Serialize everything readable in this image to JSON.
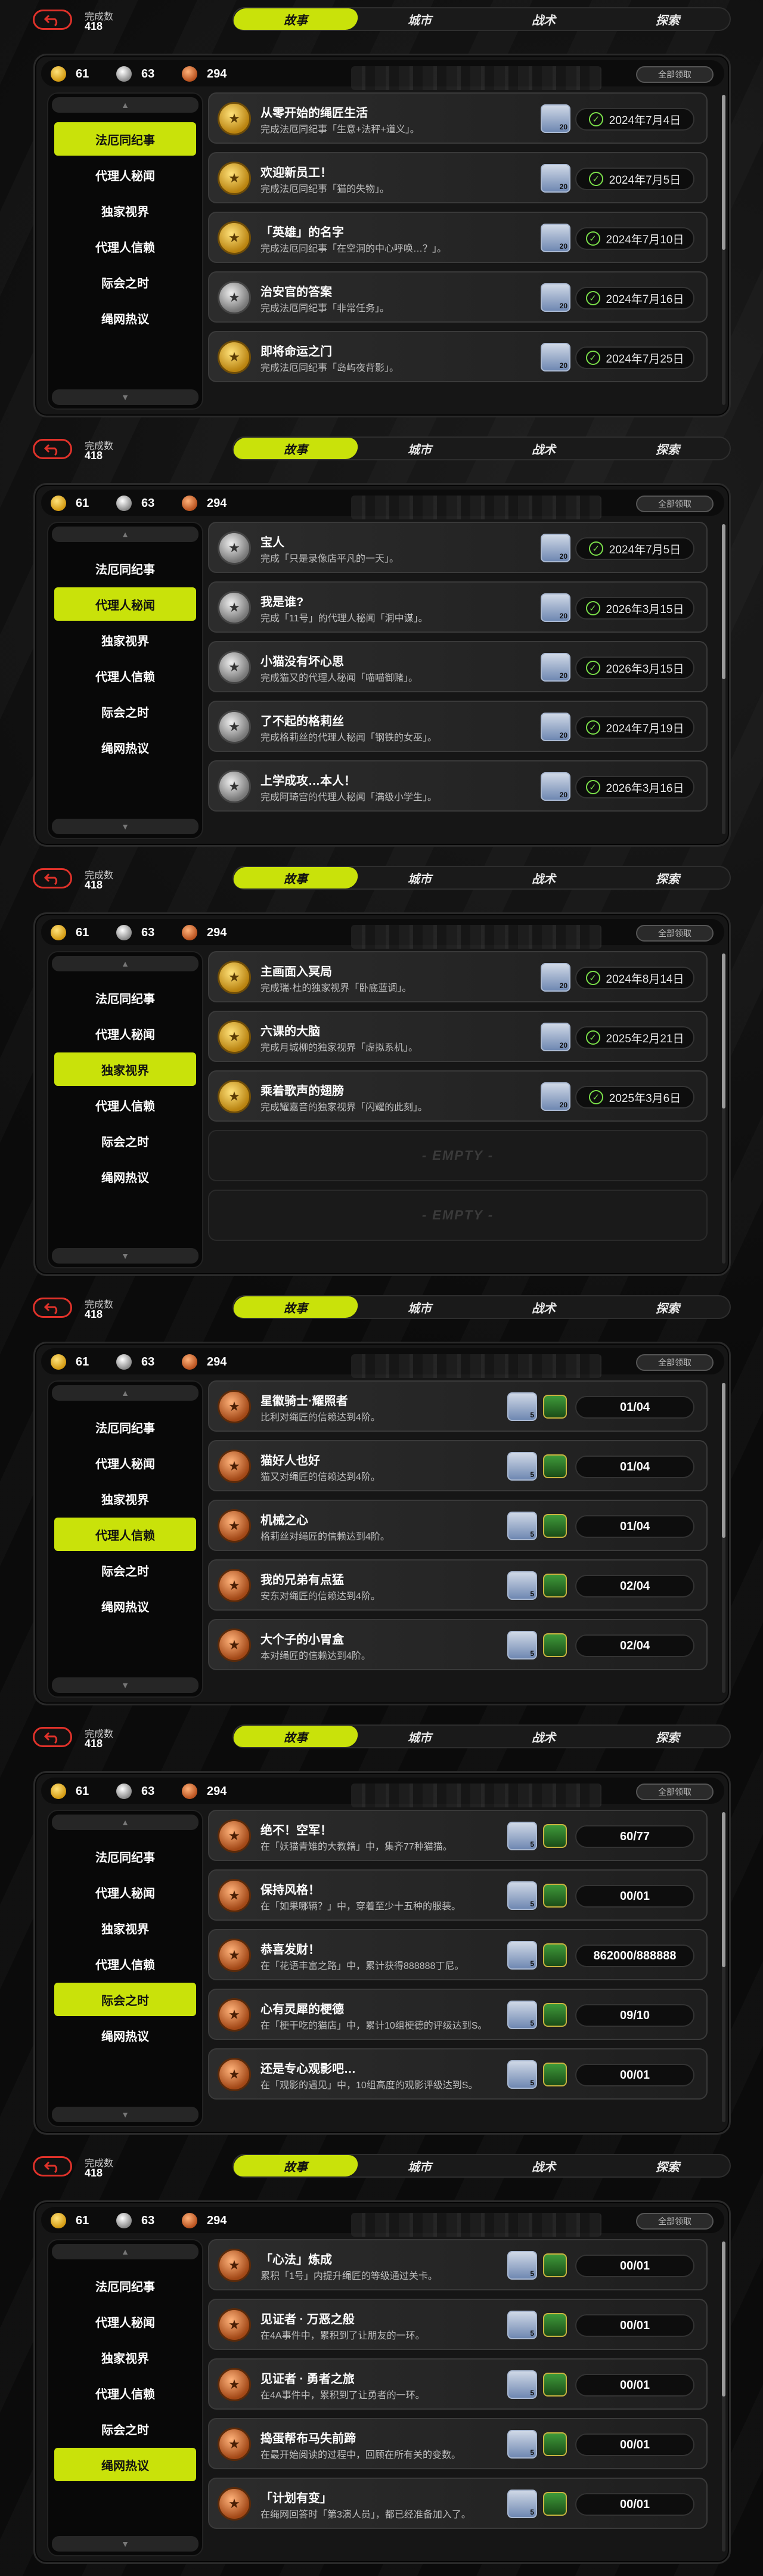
{
  "header": {
    "completion_label": "完成数",
    "completion_value": "418",
    "tabs": [
      "故事",
      "城市",
      "战术",
      "探索"
    ],
    "active_tab": 0
  },
  "currency": {
    "gold": "61",
    "silver": "63",
    "bronze": "294"
  },
  "claim_all_label": "全部领取",
  "categories": [
    "法厄同纪事",
    "代理人秘闻",
    "独家视界",
    "代理人信赖",
    "际会之时",
    "绳网热议"
  ],
  "screens": [
    {
      "active_category": 0,
      "cards": [
        {
          "medal": "gold",
          "title": "从零开始的绳匠生活",
          "desc": "完成法厄同纪事「生意+法秤+道义」。",
          "reward_qty": "20",
          "date": "2024年7月4日"
        },
        {
          "medal": "gold",
          "title": "欢迎新员工！",
          "desc": "完成法厄同纪事「猫的失物」。",
          "reward_qty": "20",
          "date": "2024年7月5日"
        },
        {
          "medal": "gold",
          "title": "「英雄」的名字",
          "desc": "完成法厄同纪事「在空洞的中心呼唤…？」。",
          "reward_qty": "20",
          "date": "2024年7月10日"
        },
        {
          "medal": "grey",
          "title": "治安官的答案",
          "desc": "完成法厄同纪事「非常任务」。",
          "reward_qty": "20",
          "date": "2024年7月16日"
        },
        {
          "medal": "gold",
          "title": "即将命运之门",
          "desc": "完成法厄同纪事「岛屿夜背影」。",
          "reward_qty": "20",
          "date": "2024年7月25日"
        }
      ]
    },
    {
      "active_category": 1,
      "cards": [
        {
          "medal": "grey",
          "title": "宝人",
          "desc": "完成「只是录像店平凡的一天」。",
          "reward_qty": "20",
          "date": "2024年7月5日"
        },
        {
          "medal": "grey",
          "title": "我是谁?",
          "desc": "完成「11号」的代理人秘闻「洞中谋」。",
          "reward_qty": "20",
          "date": "2026年3月15日"
        },
        {
          "medal": "grey",
          "title": "小猫没有坏心思",
          "desc": "完成猫又的代理人秘闻「喵喵御赌」。",
          "reward_qty": "20",
          "date": "2026年3月15日"
        },
        {
          "medal": "grey",
          "title": "了不起的格莉丝",
          "desc": "完成格莉丝的代理人秘闻「钢铁的女巫」。",
          "reward_qty": "20",
          "date": "2024年7月19日"
        },
        {
          "medal": "grey",
          "title": "上学成攻…本人！",
          "desc": "完成阿琦宫的代理人秘闻「满级小学生」。",
          "reward_qty": "20",
          "date": "2026年3月16日"
        }
      ]
    },
    {
      "active_category": 2,
      "cards": [
        {
          "medal": "gold",
          "title": "主画面入冥局",
          "desc": "完成瑞·杜的独家视界「卧底蓝调」。",
          "reward_qty": "20",
          "date": "2024年8月14日"
        },
        {
          "medal": "gold",
          "title": "六课的大脑",
          "desc": "完成月城柳的独家视界「虚拟系机」。",
          "reward_qty": "20",
          "date": "2025年2月21日"
        },
        {
          "medal": "gold",
          "title": "乘着歌声的翅膀",
          "desc": "完成耀嘉音的独家视界「闪耀的此刻」。",
          "reward_qty": "20",
          "date": "2025年3月6日"
        }
      ],
      "empty_label": "- EMPTY -",
      "empty_count": 2
    },
    {
      "active_category": 3,
      "cards": [
        {
          "medal": "bronze",
          "title": "星徽骑士·耀照者",
          "desc": "比利对绳匠的信赖达到4阶。",
          "reward_qty": "5",
          "progress": "01/04"
        },
        {
          "medal": "bronze",
          "title": "猫好人也好",
          "desc": "猫又对绳匠的信赖达到4阶。",
          "reward_qty": "5",
          "progress": "01/04"
        },
        {
          "medal": "bronze",
          "title": "机械之心",
          "desc": "格莉丝对绳匠的信赖达到4阶。",
          "reward_qty": "5",
          "progress": "01/04"
        },
        {
          "medal": "bronze",
          "title": "我的兄弟有点猛",
          "desc": "安东对绳匠的信赖达到4阶。",
          "reward_qty": "5",
          "progress": "02/04"
        },
        {
          "medal": "bronze",
          "title": "大个子的小胃盒",
          "desc": "本对绳匠的信赖达到4阶。",
          "reward_qty": "5",
          "progress": "02/04"
        }
      ]
    },
    {
      "active_category": 4,
      "cards": [
        {
          "medal": "bronze",
          "title": "绝不！空军！",
          "desc": "在「妖猫青雉的大教籍」中，集齐77种猫猫。",
          "reward_qty": "5",
          "progress": "60/77"
        },
        {
          "medal": "bronze",
          "title": "保持风格！",
          "desc": "在「如果哪辆？」中，穿着至少十五种的服装。",
          "reward_qty": "5",
          "progress": "00/01"
        },
        {
          "medal": "bronze",
          "title": "恭喜发财！",
          "desc": "在「花语丰富之路」中，累计获得888888丁尼。",
          "reward_qty": "5",
          "progress": "862000/888888"
        },
        {
          "medal": "bronze",
          "title": "心有灵犀的梗德",
          "desc": "在「梗干吃的猫店」中，累计10组梗德的评级达到S。",
          "reward_qty": "5",
          "progress": "09/10"
        },
        {
          "medal": "bronze",
          "title": "还是专心观影吧…",
          "desc": "在「观影的遇见」中，10组高度的观影评级达到S。",
          "reward_qty": "5",
          "progress": "00/01"
        }
      ]
    },
    {
      "active_category": 5,
      "cards": [
        {
          "medal": "bronze",
          "title": "「心法」炼成",
          "desc": "累积「1号」内提升绳匠的等级通过关卡。",
          "reward_qty": "5",
          "progress": "00/01"
        },
        {
          "medal": "bronze",
          "title": "见证者 · 万恶之般",
          "desc": "在4A事件中，累积到了让朋友的一环。",
          "reward_qty": "5",
          "progress": "00/01"
        },
        {
          "medal": "bronze",
          "title": "见证者 · 勇者之旅",
          "desc": "在4A事件中，累积到了让勇者的一环。",
          "reward_qty": "5",
          "progress": "00/01"
        },
        {
          "medal": "bronze",
          "title": "捣蛋帮布马失前蹄",
          "desc": "在最开始阅读的过程中，回顾在所有关的变数。",
          "reward_qty": "5",
          "progress": "00/01"
        },
        {
          "medal": "bronze",
          "title": "「计划有变」",
          "desc": "在绳网回答时「第3演人员」，都已经准备加入了。",
          "reward_qty": "5",
          "progress": "00/01"
        }
      ]
    }
  ]
}
